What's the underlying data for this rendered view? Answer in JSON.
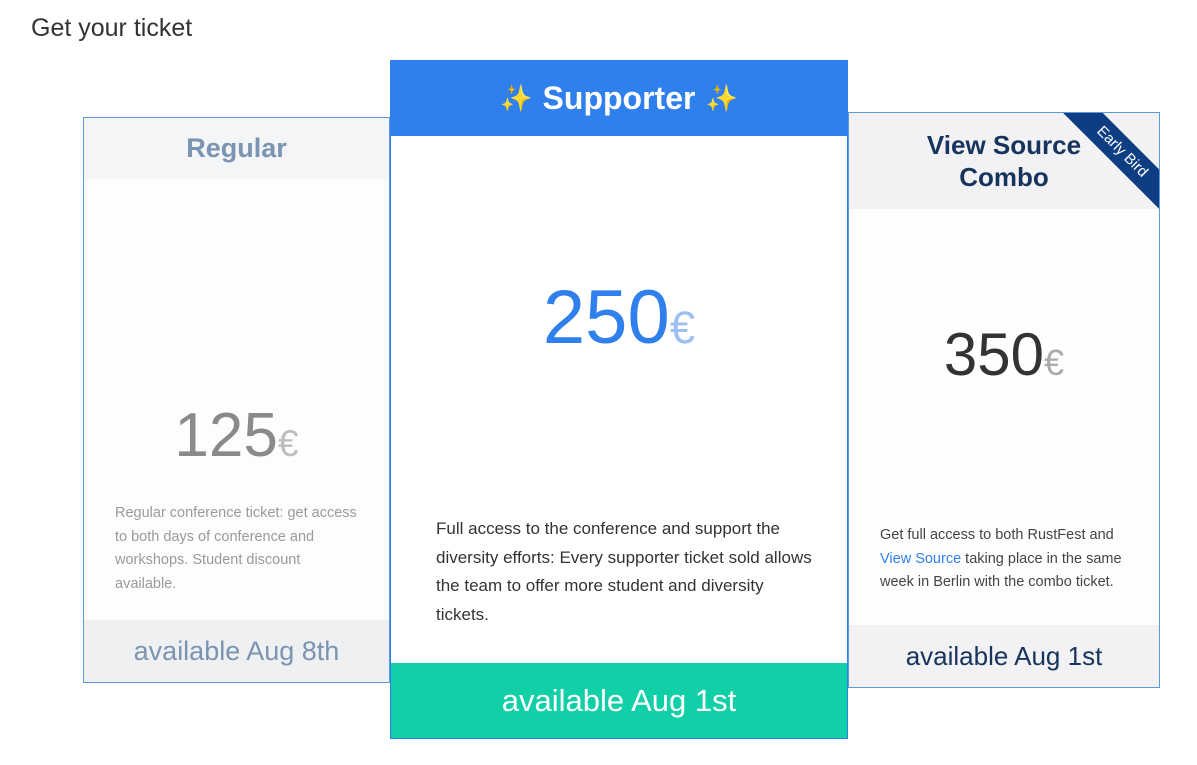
{
  "page": {
    "title": "Get your ticket"
  },
  "tickets": [
    {
      "name": "Regular",
      "price": "125",
      "currency": "€",
      "description": "Regular conference ticket: get access to both days of conference and workshops. Student discount available.",
      "availability": "available Aug 8th"
    },
    {
      "name": "Supporter",
      "sparkle": "✨",
      "price": "250",
      "currency": "€",
      "description": "Full access to the conference and support the diversity efforts: Every supporter ticket sold allows the team to offer more student and diversity tickets.",
      "availability": "available Aug 1st"
    },
    {
      "name": "View Source Combo",
      "ribbon": "Early Bird",
      "price": "350",
      "currency": "€",
      "description_before": "Get full access to both RustFest and ",
      "description_link": "View Source",
      "description_after": " taking place in the same week in Berlin with the combo ticket.",
      "availability": "available Aug 1st"
    }
  ],
  "colors": {
    "accent_blue": "#2f80ed",
    "teal": "#11d0a7",
    "navy": "#16345c",
    "ribbon": "#0f3d82"
  }
}
